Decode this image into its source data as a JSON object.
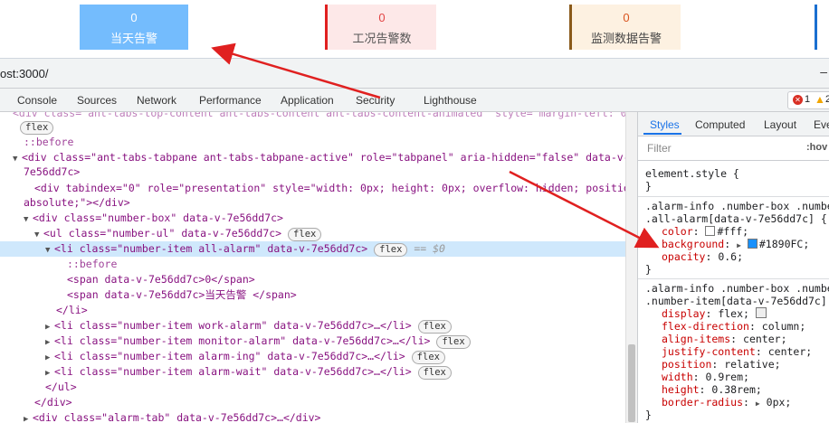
{
  "app": {
    "cards": [
      {
        "count": "0",
        "label": "当天告警"
      },
      {
        "count": "0",
        "label": "工况告警数"
      },
      {
        "count": "0",
        "label": "监测数据告警"
      }
    ]
  },
  "devtools": {
    "url": "ost:3000/",
    "minimize": "–",
    "tabs": [
      "Console",
      "Sources",
      "Network",
      "Performance",
      "Application",
      "Security",
      "Lighthouse"
    ],
    "issues": {
      "errors": "1",
      "warnings": "2"
    },
    "elements": {
      "top_cut": "<div class=\"ant-tabs-top-content ant-tabs-content ant-tabs-content-animated\" style=\"margin-left: 0%;\">",
      "flex": "flex",
      "before": "::before",
      "tabpane_open": "<div class=\"ant-tabs-tabpane ant-tabs-tabpane-active\" role=\"tabpanel\" aria-hidden=\"false\" data-v-",
      "tabpane_cont": "7e56dd7c>",
      "tabindex_line1": "<div tabindex=\"0\" role=\"presentation\" style=\"width: 0px; height: 0px; overflow: hidden; position:",
      "tabindex_line2": "absolute;\"></div>",
      "numberbox": "<div class=\"number-box\" data-v-7e56dd7c>",
      "numberul": "<ul class=\"number-ul\" data-v-7e56dd7c>",
      "li_all": "<li class=\"number-item all-alarm\" data-v-7e56dd7c>",
      "eq": "== $0",
      "span1": "<span data-v-7e56dd7c>0</span>",
      "span2": "<span data-v-7e56dd7c>当天告警 </span>",
      "li_close": "</li>",
      "li_work": "<li class=\"number-item work-alarm\" data-v-7e56dd7c>…</li>",
      "li_monitor": "<li class=\"number-item monitor-alarm\" data-v-7e56dd7c>…</li>",
      "li_ing": "<li class=\"number-item alarm-ing\" data-v-7e56dd7c>…</li>",
      "li_wait": "<li class=\"number-item alarm-wait\" data-v-7e56dd7c>…</li>",
      "ul_close": "</ul>",
      "div_close": "</div>",
      "alarmtab": "<div class=\"alarm-tab\" data-v-7e56dd7c>…</div>"
    },
    "styles": {
      "tabs": [
        "Styles",
        "Computed",
        "Layout",
        "Eve"
      ],
      "filter_placeholder": "Filter",
      "hov": ":hov",
      "element_style": "element.style {",
      "close": "}",
      "rule1_sel1": ".alarm-info .number-box .number",
      "rule1_sel2": ".all-alarm[data-v-7e56dd7c] {",
      "rule1_props": [
        {
          "name": "color",
          "value": "#fff;",
          "swatch": "#ffffff"
        },
        {
          "name": "background",
          "value": "#1890FC;",
          "swatch": "#1890FC",
          "arrow": "▶"
        },
        {
          "name": "opacity",
          "value": "0.6;"
        }
      ],
      "rule2_sel1": ".alarm-info .number-box .number",
      "rule2_sel2": ".number-item[data-v-7e56dd7c] {",
      "rule2_props": [
        {
          "name": "display",
          "value": "flex;"
        },
        {
          "name": "flex-direction",
          "value": "column;"
        },
        {
          "name": "align-items",
          "value": "center;"
        },
        {
          "name": "justify-content",
          "value": "center;"
        },
        {
          "name": "position",
          "value": "relative;"
        },
        {
          "name": "width",
          "value": "0.9rem;"
        },
        {
          "name": "height",
          "value": "0.38rem;"
        },
        {
          "name": "border-radius",
          "value": "0px;",
          "arrow": "▶"
        }
      ]
    }
  },
  "colors": {
    "all_alarm_bg": "#1890FC",
    "work_border": "#e02020",
    "monitor_border": "#8a5a1a",
    "arrow": "#e02020",
    "selected_row": "#cfe8fc"
  }
}
